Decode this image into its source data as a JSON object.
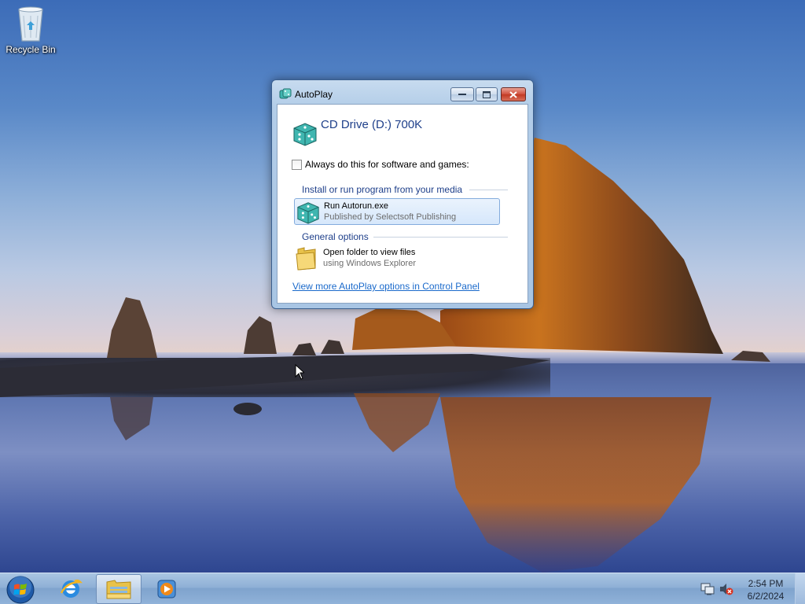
{
  "desktop": {
    "icons": [
      {
        "label": "Recycle Bin",
        "icon": "recycle-bin-icon"
      }
    ]
  },
  "autoplay": {
    "window_title": "AutoPlay",
    "drive_title": "CD Drive (D:) 700K",
    "always_checkbox_label": "Always do this for software and games:",
    "always_checked": false,
    "section_install": "Install or run program from your media",
    "run_option": {
      "title": "Run Autorun.exe",
      "subtitle": "Published by Selectsoft Publishing"
    },
    "section_general": "General options",
    "open_folder_option": {
      "title": "Open folder to view files",
      "subtitle": "using Windows Explorer"
    },
    "control_panel_link": "View more AutoPlay options in Control Panel",
    "buttons": {
      "minimize": "minimize-icon",
      "maximize": "maximize-icon",
      "close": "close-icon"
    }
  },
  "taskbar": {
    "pinned": [
      "start-orb-icon",
      "internet-explorer-icon",
      "windows-explorer-icon",
      "media-player-icon"
    ],
    "tray": {
      "time": "2:54 PM",
      "date": "6/2/2024"
    }
  },
  "colors": {
    "accent_text": "#1e3f8a",
    "link": "#1b6acb",
    "close_button": "#c23a23"
  }
}
